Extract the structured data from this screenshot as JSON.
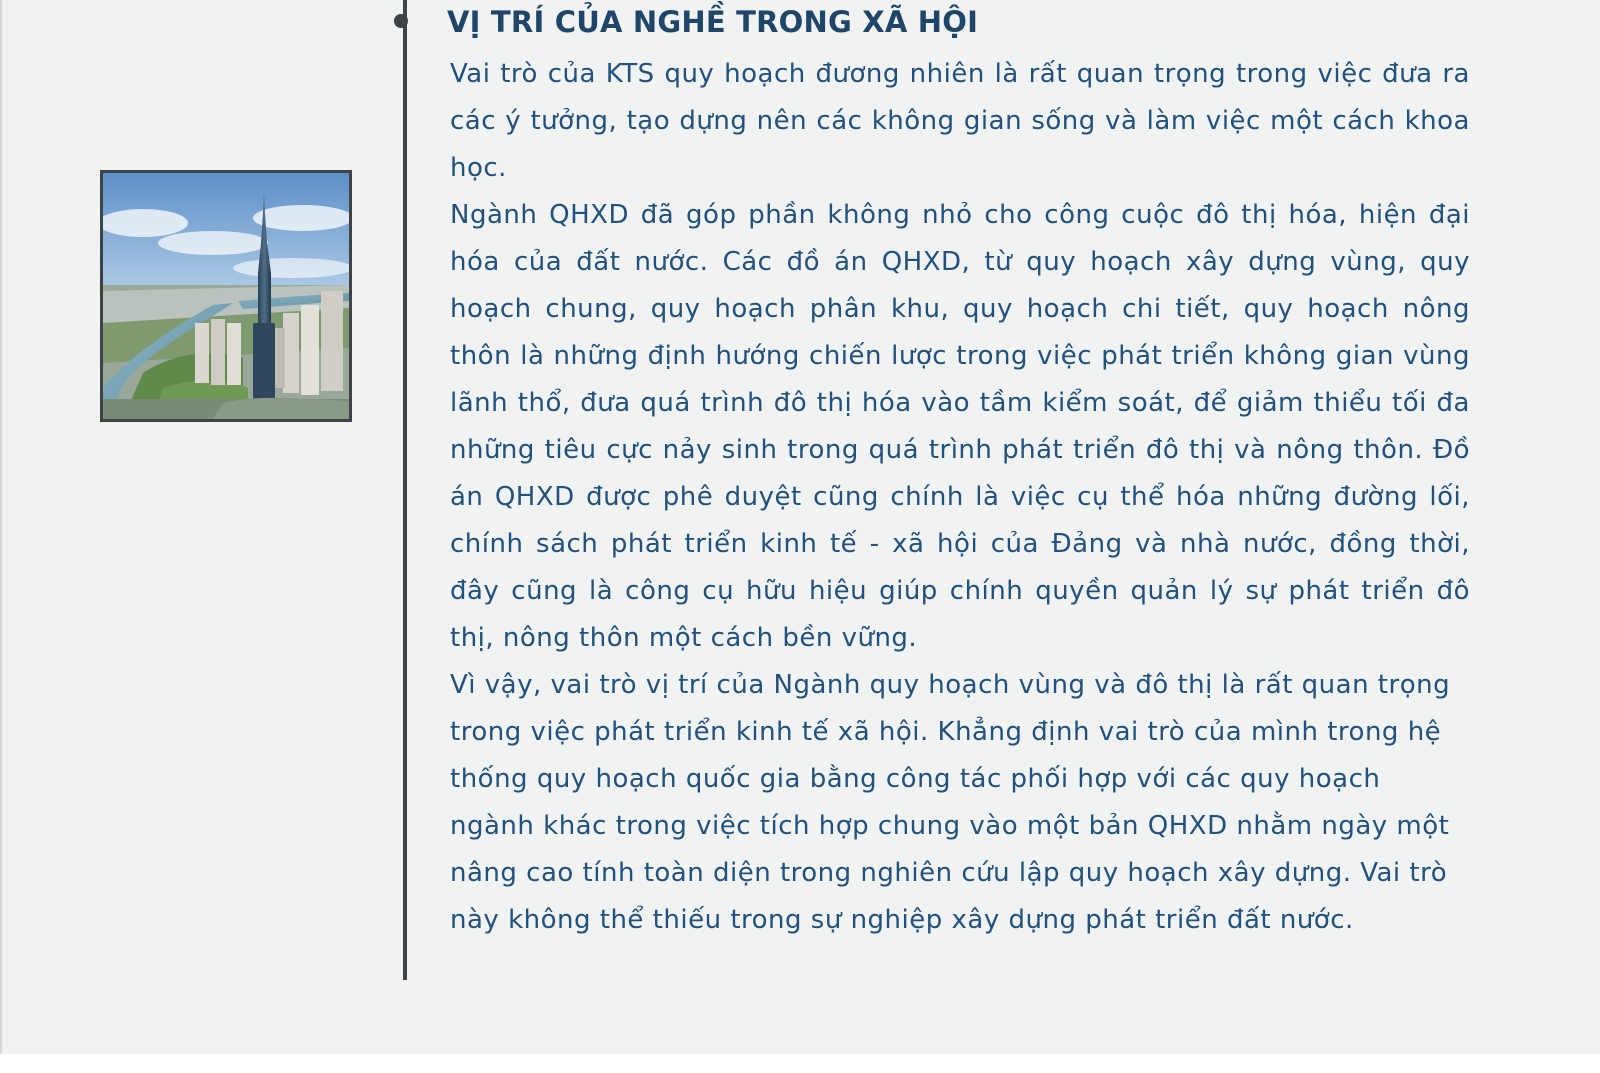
{
  "heading": "VỊ TRÍ CỦA NGHỀ TRONG XÃ HỘI",
  "paragraphs": [
    "Vai trò của KTS quy hoạch đương nhiên là rất quan trọng trong việc đưa ra các ý tưởng, tạo dựng nên các không gian sống và làm việc một cách khoa học.",
    "Ngành QHXD đã góp phần không nhỏ cho công cuộc đô thị hóa, hiện đại hóa của đất nước. Các đồ án QHXD, từ quy hoạch xây dựng vùng, quy hoạch chung, quy hoạch phân khu, quy hoạch chi tiết, quy hoạch nông thôn là những định hướng chiến lược trong việc phát triển không gian vùng lãnh thổ, đưa quá trình đô thị hóa vào tầm kiểm soát, để giảm thiểu tối đa những tiêu cực nảy sinh trong quá trình phát triển đô thị và nông thôn. Đồ án QHXD được phê duyệt cũng chính là việc cụ thể hóa những đường lối, chính sách phát triển kinh tế - xã hội của Đảng và nhà nước, đồng thời, đây cũng là công cụ hữu hiệu giúp chính quyền quản lý sự phát triển đô thị, nông thôn một cách bền vững.",
    "Vì vậy, vai trò vị trí của Ngành quy hoạch vùng và đô thị là rất quan trọng trong việc phát triển kinh tế xã hội. Khẳng định vai trò của mình trong hệ thống quy hoạch quốc gia bằng công tác phối hợp với các quy hoạch ngành khác trong việc tích hợp chung vào một bản QHXD nhằm ngày một nâng cao tính toàn diện trong nghiên cứu lập quy hoạch xây dựng. Vai trò này không thể thiếu trong sự nghiệp xây dựng phát triển đất nước."
  ],
  "colors": {
    "background": "#f1f2f2",
    "heading": "#1f4569",
    "body_text": "#21517c",
    "timeline": "#3e4347",
    "photo_border": "#3e4347"
  },
  "image": {
    "icon": "city-skyline-photo"
  }
}
